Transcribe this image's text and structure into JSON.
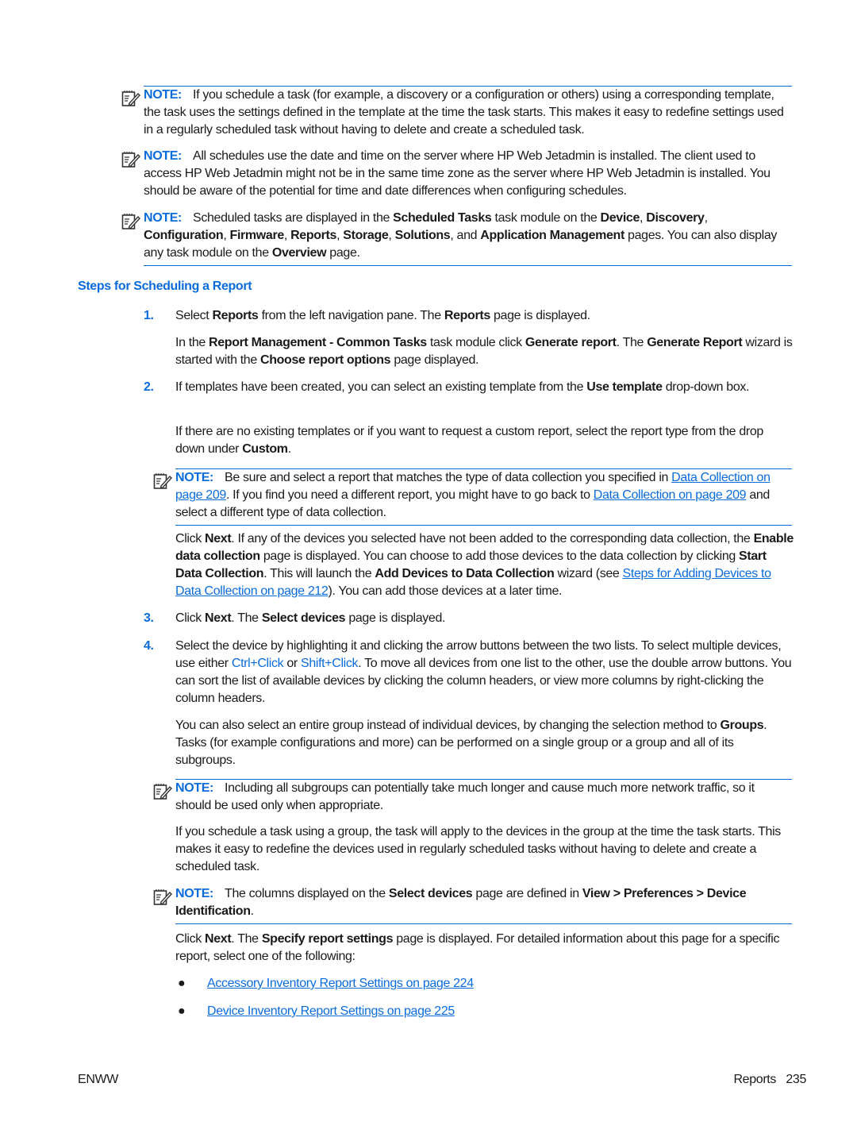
{
  "notes": {
    "label": "NOTE:",
    "n1": {
      "text": "If you schedule a task (for example, a discovery or a configuration or others) using a corresponding template, the task uses the settings defined in the template at the time the task starts. This makes it easy to redefine settings used in a regularly scheduled task without having to delete and create a scheduled task."
    },
    "n2": {
      "text": "All schedules use the date and time on the server where HP Web Jetadmin is installed. The client used to access HP Web Jetadmin might not be in the same time zone as the server where HP Web Jetadmin is installed. You should be aware of the potential for time and date differences when configuring schedules."
    },
    "n3": {
      "t1": "Scheduled tasks are displayed in the ",
      "b1": "Scheduled Tasks",
      "t2": " task module on the ",
      "b2": "Device",
      "t3": ", ",
      "b3": "Discovery",
      "t4": ", ",
      "b4": "Configuration",
      "t5": ", ",
      "b5": "Firmware",
      "t6": ", ",
      "b6": "Reports",
      "t7": ", ",
      "b7": "Storage",
      "t8": ", ",
      "b8": "Solutions",
      "t9": ", and ",
      "b9": "Application Management",
      "t10": " pages. You can also display any task module on the ",
      "b10": "Overview",
      "t11": " page."
    },
    "n4": {
      "t1": "Be sure and select a report that matches the type of data collection you specified in ",
      "link1": "Data Collection on page 209",
      "t2": ". If you find you need a different report, you might have to go back to ",
      "link2": "Data Collection on page 209",
      "t3": " and select a different type of data collection."
    },
    "n5": {
      "text": "Including all subgroups can potentially take much longer and cause much more network traffic, so it should be used only when appropriate."
    },
    "n6": {
      "t1": "The columns displayed on the ",
      "b1": "Select devices",
      "t2": " page are defined in ",
      "b2": "View > Preferences > Device Identification",
      "t3": "."
    }
  },
  "heading": "Steps for Scheduling a Report",
  "steps": {
    "s1": {
      "num": "1.",
      "t1": "Select ",
      "b1": "Reports",
      "t2": " from the left navigation pane. The ",
      "b2": "Reports",
      "t3": " page is displayed.",
      "p2": {
        "t1": "In the ",
        "b1": "Report Management - Common Tasks",
        "t2": " task module click ",
        "b2": "Generate report",
        "t3": ". The ",
        "b3": "Generate Report",
        "t4": " wizard is started with the ",
        "b4": "Choose report options",
        "t5": " page displayed."
      }
    },
    "s2": {
      "num": "2.",
      "t1": "If templates have been created, you can select an existing template from the ",
      "b1": "Use template",
      "t2": " drop-down box.",
      "p2": {
        "t1": "If there are no existing templates or if you want to request a custom report, select the report type from the drop down under ",
        "b1": "Custom",
        "t2": "."
      },
      "p3": {
        "t1": "Click ",
        "b1": "Next",
        "t2": ". If any of the devices you selected have not been added to the corresponding data collection, the ",
        "b2": "Enable data collection",
        "t3": " page is displayed. You can choose to add those devices to the data collection by clicking ",
        "b3": "Start Data Collection",
        "t4": ". This will launch the ",
        "b4": "Add Devices to Data Collection",
        "t5": " wizard (see ",
        "link": "Steps for Adding Devices to Data Collection on page 212",
        "t6": "). You can add those devices at a later time."
      }
    },
    "s3": {
      "num": "3.",
      "t1": "Click ",
      "b1": "Next",
      "t2": ". The ",
      "b2": "Select devices",
      "t3": " page is displayed."
    },
    "s4": {
      "num": "4.",
      "t1": "Select the device by highlighting it and clicking the arrow buttons between the two lists. To select multiple devices, use either ",
      "k1": "Ctrl+Click",
      "t2": " or ",
      "k2": "Shift+Click",
      "t3": ". To move all devices from one list to the other, use the double arrow buttons. You can sort the list of available devices by clicking the column headers, or view more columns by right-clicking the column headers.",
      "p2": {
        "t1": "You can also select an entire group instead of individual devices, by changing the selection method to ",
        "b1": "Groups",
        "t2": ". Tasks (for example configurations and more) can be performed on a single group or a group and all of its subgroups."
      },
      "p3": {
        "text": "If you schedule a task using a group, the task will apply to the devices in the group at the time the task starts. This makes it easy to redefine the devices used in regularly scheduled tasks without having to delete and create a scheduled task."
      },
      "p4": {
        "t1": "Click ",
        "b1": "Next",
        "t2": ". The ",
        "b2": "Specify report settings",
        "t3": " page is displayed. For detailed information about this page for a specific report, select one of the following:"
      },
      "links": [
        {
          "bullet": "●",
          "label": "Accessory Inventory Report Settings on page 224"
        },
        {
          "bullet": "●",
          "label": "Device Inventory Report Settings on page 225"
        }
      ]
    }
  },
  "footer": {
    "left": "ENWW",
    "section": "Reports",
    "page": "235"
  }
}
